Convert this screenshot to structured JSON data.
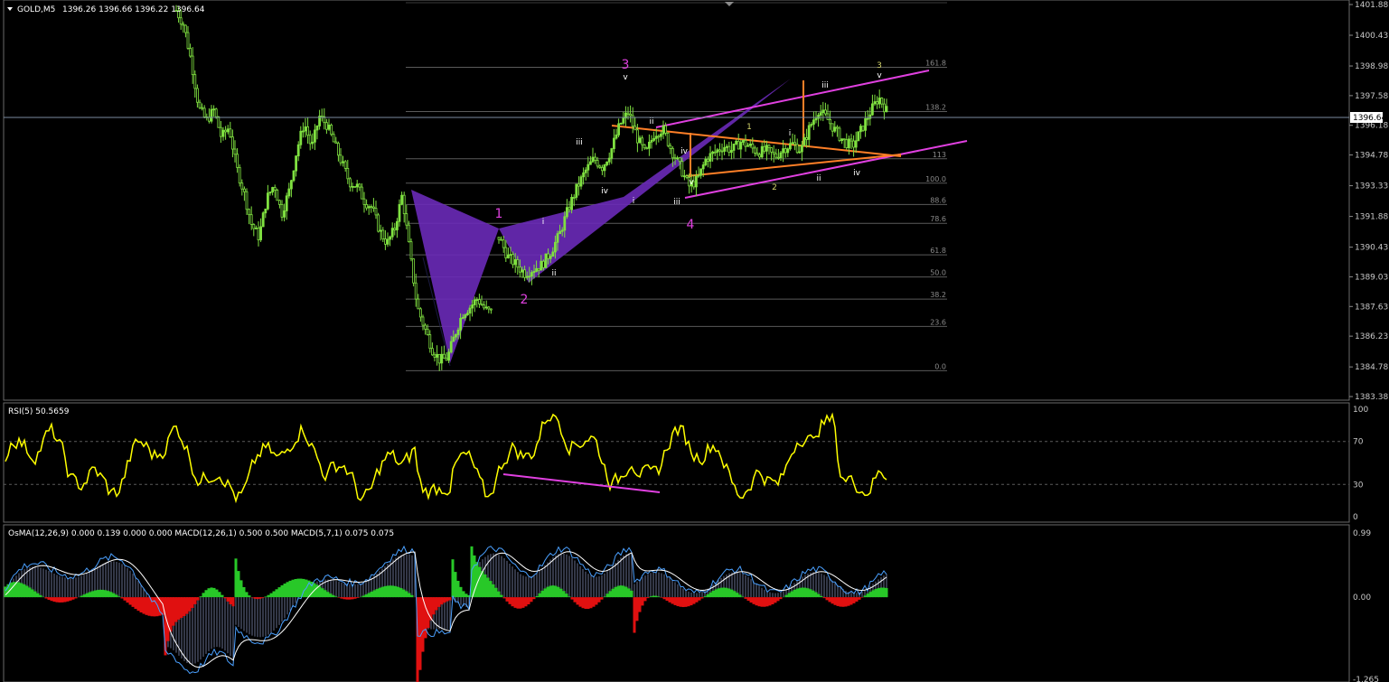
{
  "header": {
    "symbol": "GOLD,M5",
    "prices": "1396.26 1396.66 1396.22 1396.64"
  },
  "price_axis": {
    "ticks": [
      "1401.88",
      "1400.43",
      "1398.98",
      "1397.58",
      "1396.18",
      "1394.78",
      "1393.33",
      "1391.88",
      "1390.43",
      "1389.03",
      "1387.63",
      "1386.23",
      "1384.78",
      "1383.38"
    ],
    "current_price": "1396.64"
  },
  "fib_levels": [
    "161.8",
    "138.2",
    "113",
    "100.0",
    "88.6",
    "78.6",
    "61.8",
    "50.0",
    "38.2",
    "23.6",
    "0.0"
  ],
  "wave_labels": {
    "big": [
      {
        "text": "1",
        "color": "#e040e0"
      },
      {
        "text": "2",
        "color": "#e040e0"
      },
      {
        "text": "3",
        "color": "#e040e0"
      },
      {
        "text": "4",
        "color": "#e040e0"
      }
    ],
    "small": [
      "i",
      "ii",
      "iii",
      "iv",
      "v",
      "i",
      "ii",
      "iii",
      "iv",
      "v",
      "1",
      "2",
      "3",
      "i",
      "ii",
      "iii",
      "iv",
      "v"
    ]
  },
  "rsi": {
    "label": "RSI(5) 50.5659",
    "ticks": [
      "100",
      "70",
      "30",
      "0"
    ]
  },
  "macd": {
    "label": "OsMA(12,26,9) 0.000 0.139 0.000 0.000  MACD(12,26,1) 0.500 0.500  MACD(5,7,1) 0.075 0.075",
    "ticks": [
      "0.99",
      "0.00",
      "-1.265"
    ]
  },
  "colors": {
    "candle": "#7fe040",
    "magenta": "#e040e0",
    "orange": "#ff7f27",
    "purple": "#6a2ab8",
    "rsi": "#ffff00",
    "osma_pos": "#28c828",
    "osma_neg": "#e01010",
    "macd_line": "#4aa0ff"
  },
  "chart_data": [
    {
      "type": "candlestick",
      "title": "GOLD,M5",
      "ylim": [
        1383.38,
        1401.88
      ],
      "close_path": [
        1401.6,
        1400.9,
        1399.2,
        1397.0,
        1396.4,
        1396.9,
        1395.6,
        1396.1,
        1394.2,
        1393.0,
        1391.5,
        1390.9,
        1392.7,
        1393.4,
        1392.0,
        1393.1,
        1395.0,
        1396.3,
        1395.1,
        1396.6,
        1396.2,
        1395.3,
        1394.4,
        1393.5,
        1393.3,
        1392.6,
        1392.3,
        1391.2,
        1390.6,
        1391.3,
        1392.9,
        1390.2,
        1387.6,
        1386.6,
        1385.6,
        1385.1,
        1385.2,
        1386.3,
        1387.3,
        1387.6,
        1388.0,
        1387.5,
        1387.3
      ]
    },
    {
      "type": "line",
      "title": "RSI(5) 50.5659",
      "ylim": [
        0,
        100
      ]
    },
    {
      "type": "bar",
      "title": "OsMA(12,26,9) / MACD",
      "ylim": [
        -1.265,
        0.99
      ]
    }
  ]
}
